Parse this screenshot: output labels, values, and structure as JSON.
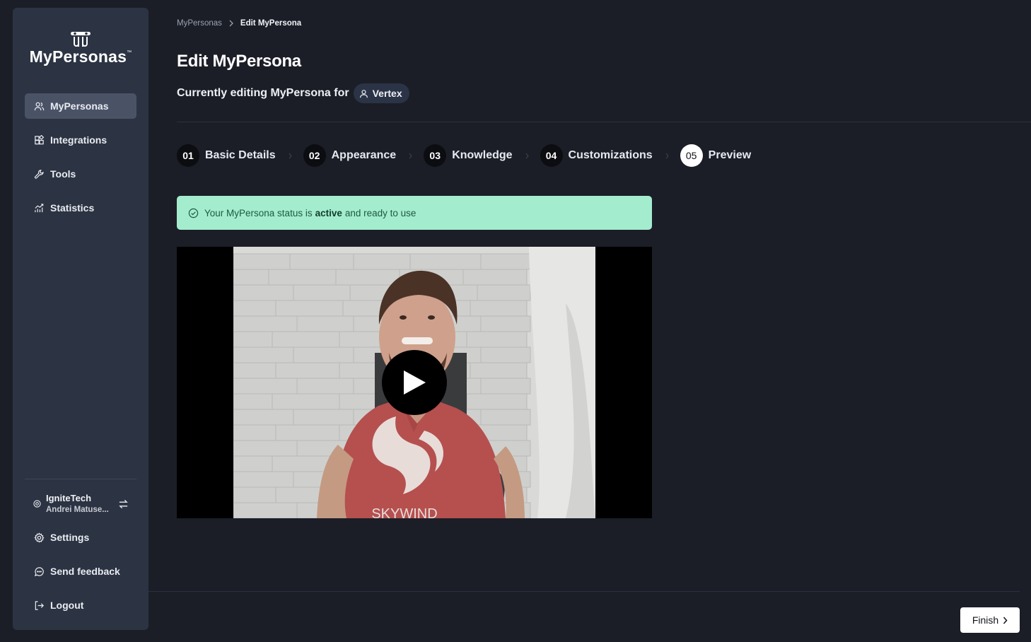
{
  "app": {
    "logo_text": "MyPersonas",
    "logo_tm": "™"
  },
  "sidebar": {
    "items": [
      {
        "label": "MyPersonas",
        "icon": "users-icon",
        "active": true
      },
      {
        "label": "Integrations",
        "icon": "integrations-icon",
        "active": false
      },
      {
        "label": "Tools",
        "icon": "wrench-icon",
        "active": false
      },
      {
        "label": "Statistics",
        "icon": "chart-icon",
        "active": false
      }
    ],
    "org": {
      "name": "IgniteTech",
      "user": "Andrei Matuse..."
    },
    "bottom_items": [
      {
        "label": "Settings",
        "icon": "gear-icon"
      },
      {
        "label": "Send feedback",
        "icon": "chat-bubble-icon"
      },
      {
        "label": "Logout",
        "icon": "logout-icon"
      }
    ]
  },
  "breadcrumb": {
    "parent": "MyPersonas",
    "current": "Edit MyPersona"
  },
  "page": {
    "title": "Edit MyPersona",
    "subtitle": "Currently editing MyPersona for",
    "persona_chip": "Vertex"
  },
  "steps": [
    {
      "num": "01",
      "label": "Basic Details",
      "current": false
    },
    {
      "num": "02",
      "label": "Appearance",
      "current": false
    },
    {
      "num": "03",
      "label": "Knowledge",
      "current": false
    },
    {
      "num": "04",
      "label": "Customizations",
      "current": false
    },
    {
      "num": "05",
      "label": "Preview",
      "current": true
    }
  ],
  "alert": {
    "prefix": "Your MyPersona status is",
    "status": "active",
    "suffix": "and ready to use",
    "color": "#a4ecce"
  },
  "video": {
    "shirt_text": "SKYWIND"
  },
  "footer": {
    "finish_label": "Finish"
  }
}
